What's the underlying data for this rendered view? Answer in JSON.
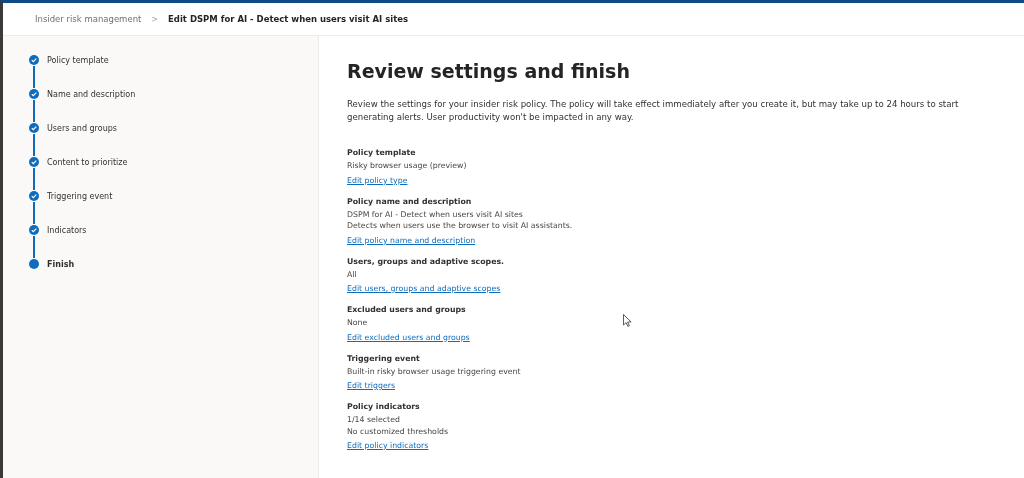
{
  "breadcrumb": [
    {
      "label": "Insider risk management",
      "current": false
    },
    {
      "label": "Edit DSPM for AI - Detect when users visit AI sites",
      "current": true
    }
  ],
  "breadcrumb_separator": ">",
  "steps": [
    {
      "label": "Policy template",
      "kind": "completed"
    },
    {
      "label": "Name and description",
      "kind": "completed"
    },
    {
      "label": "Users and groups",
      "kind": "completed"
    },
    {
      "label": "Content to prioritize",
      "kind": "completed"
    },
    {
      "label": "Triggering event",
      "kind": "completed"
    },
    {
      "label": "Indicators",
      "kind": "completed"
    },
    {
      "label": "Finish",
      "kind": "current"
    }
  ],
  "title": "Review settings and finish",
  "description": "Review the settings for your insider risk policy. The policy will take effect immediately after you create it, but may take up to 24 hours to start generating alerts. User productivity won't be impacted in any way.",
  "sections": [
    {
      "heading": "Policy template",
      "values": [
        "Risky browser usage (preview)"
      ],
      "link": "Edit policy type"
    },
    {
      "heading": "Policy name and description",
      "values": [
        "DSPM for AI - Detect when users visit AI sites",
        "Detects when users use the browser to visit AI assistants."
      ],
      "link": "Edit policy name and description"
    },
    {
      "heading": "Users, groups and adaptive scopes.",
      "values": [
        "All"
      ],
      "link": "Edit users, groups and adaptive scopes"
    },
    {
      "heading": "Excluded users and groups",
      "values": [
        "None"
      ],
      "link": "Edit excluded users and groups"
    },
    {
      "heading": "Triggering event",
      "values": [
        "Built-in risky browser usage triggering event"
      ],
      "link": "Edit triggers"
    },
    {
      "heading": "Policy indicators",
      "values": [
        "1/14 selected",
        "No customized thresholds"
      ],
      "link": "Edit policy indicators"
    }
  ]
}
